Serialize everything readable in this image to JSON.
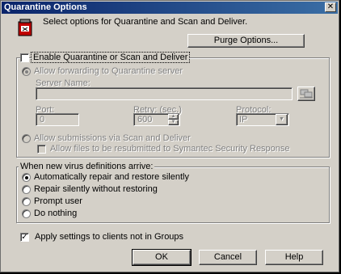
{
  "window": {
    "title": "Quarantine Options",
    "close_glyph": "✕"
  },
  "header": {
    "text": "Select options for Quarantine and Scan and Deliver.",
    "icon": "quarantine-icon"
  },
  "purge_button": "Purge Options...",
  "enable_group": {
    "label": "Enable Quarantine or Scan and Deliver",
    "checked": false,
    "forward_radio": "Allow forwarding to Quarantine server",
    "server_name_label": "Server Name:",
    "server_name_value": "",
    "port_label": "Port:",
    "port_value": "0",
    "retry_label": "Retry: (sec.)",
    "retry_value": "600",
    "protocol_label": "Protocol:",
    "protocol_value": "IP",
    "submissions_radio": "Allow submissions via Scan and Deliver",
    "resubmit_check": "Allow files to be resubmitted to Symantec Security Response"
  },
  "defs_group": {
    "label": "When new virus definitions arrive:",
    "options": [
      {
        "label": "Automatically repair and restore silently",
        "selected": true
      },
      {
        "label": "Repair silently without restoring",
        "selected": false
      },
      {
        "label": "Prompt user",
        "selected": false
      },
      {
        "label": "Do nothing",
        "selected": false
      }
    ]
  },
  "apply_check": {
    "label": "Apply settings to clients not in Groups",
    "checked": true
  },
  "buttons": {
    "ok": "OK",
    "cancel": "Cancel",
    "help": "Help"
  }
}
